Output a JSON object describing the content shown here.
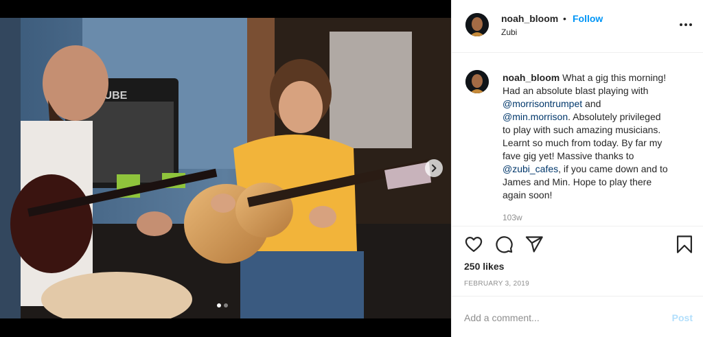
{
  "post": {
    "user": {
      "username": "noah_bloom",
      "location": "Zubi",
      "follow_label": "Follow",
      "separator": "•"
    },
    "caption": {
      "username": "noah_bloom",
      "line1": "What a gig this morning!",
      "line2": "Had an absolute blast playing with",
      "mention1": "@morrisontrumpet",
      "line3_after": "and",
      "mention2": "@min.morrison",
      "line4_after": ". Absolutely privileged",
      "line5": "to play with such amazing musicians.",
      "line6": "Learnt so much from today. By far my",
      "line7": "fave gig yet! Massive thanks to",
      "mention3": "@zubi_cafes",
      "line8_after": ", if you came down and to",
      "line9": "James and Min. Hope to play there",
      "line10": "again soon!"
    },
    "time_ago": "103w",
    "likes": "250 likes",
    "date": "February 3, 2019",
    "comment": {
      "placeholder": "Add a comment...",
      "post_label": "Post"
    },
    "carousel": {
      "slide_count": 2,
      "current_slide": 1
    },
    "icons": {
      "like": "heart-icon",
      "comment": "comment-bubble-icon",
      "share": "paper-plane-icon",
      "save": "bookmark-icon",
      "more": "more-options-icon",
      "next": "chevron-right-icon"
    },
    "colors": {
      "accent": "#0095f6",
      "mention": "#00376b",
      "muted": "#8e8e8e",
      "post_disabled": "#b2dffc"
    }
  }
}
